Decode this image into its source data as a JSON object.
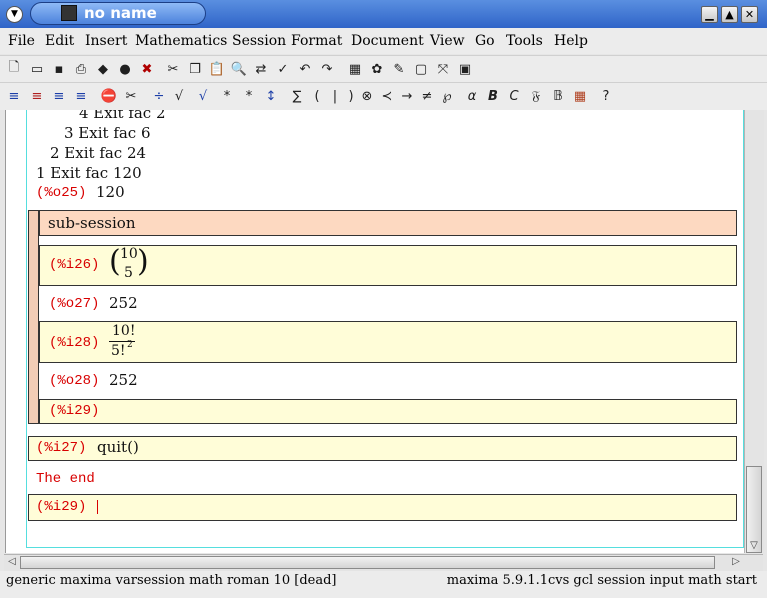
{
  "window": {
    "title": "no name"
  },
  "menu": [
    "File",
    "Edit",
    "Insert",
    "Mathematics",
    "Session",
    "Format",
    "Document",
    "View",
    "Go",
    "Tools",
    "Help"
  ],
  "session": {
    "trace": [
      "4 Exit fac 2",
      "3 Exit fac 6",
      "2 Exit fac 24",
      "1 Exit fac 120"
    ],
    "o25": {
      "label": "(%o25)",
      "value": "120"
    },
    "subsession_title": "sub-session",
    "i26": {
      "label": "(%i26)",
      "binom_top": "10",
      "binom_bottom": "5"
    },
    "o27": {
      "label": "(%o27)",
      "value": "252"
    },
    "i28": {
      "label": "(%i28)",
      "num": "10!",
      "den": "5!",
      "den_exp": "2"
    },
    "o28": {
      "label": "(%o28)",
      "value": "252"
    },
    "i29_sub": {
      "label": "(%i29)"
    },
    "i27": {
      "label": "(%i27)",
      "value": "quit()"
    },
    "end_text": "The end",
    "i29": {
      "label": "(%i29)"
    }
  },
  "status": {
    "left": "generic maxima varsession math roman 10 [dead]",
    "right": "maxima 5.9.1.1cvs gcl session input math start"
  }
}
